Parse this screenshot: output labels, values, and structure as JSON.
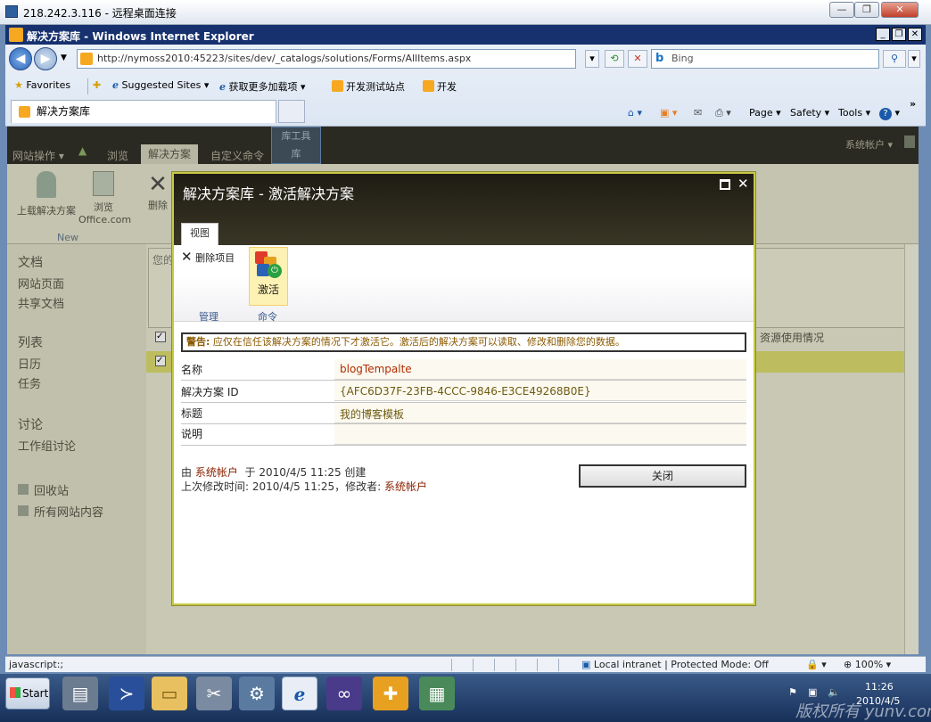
{
  "rdp": {
    "title": "218.242.3.116 - 远程桌面连接",
    "min": "—",
    "max": "❐",
    "close": "✕"
  },
  "ie": {
    "title": "解决方案库 - Windows Internet Explorer",
    "address": "http://nymoss2010:45223/sites/dev/_catalogs/solutions/Forms/AllItems.aspx",
    "search_placeholder": "Bing",
    "favorites": {
      "favorites_label": "Favorites",
      "suggested": "Suggested Sites ▾",
      "more_addons": "获取更多加载项 ▾",
      "dev_test": "开发测试站点",
      "dev": "开发"
    },
    "tab_title": "解决方案库",
    "commands": {
      "page": "Page ▾",
      "safety": "Safety ▾",
      "tools": "Tools ▾",
      "help": "?"
    }
  },
  "sharepoint": {
    "top_tabs": {
      "site_actions": "网站操作 ▾",
      "browse": "浏览",
      "solutions": "解决方案",
      "custom_cmds": "自定义命令",
      "lib_tools": "库工具",
      "library": "库"
    },
    "account": "系统帐户 ▾",
    "ribbon": {
      "upload": "上载解决方案",
      "browse_office": "浏览",
      "office_com": "Office.com",
      "delete": "删除",
      "group_new": "New"
    },
    "nav": {
      "documents": "文档",
      "site_pages": "网站页面",
      "shared_docs": "共享文档",
      "lists": "列表",
      "calendar": "日历",
      "tasks": "任务",
      "discussions": "讨论",
      "team_discussion": "工作组讨论",
      "recycle_bin": "回收站",
      "all_content": "所有网站内容"
    },
    "main": {
      "placeholder": "您的",
      "resource_col": "资源使用情况"
    }
  },
  "modal": {
    "title": "解决方案库 - 激活解决方案",
    "tab_view": "视图",
    "delete_item": "删除项目",
    "activate": "激活",
    "group_manage": "管理",
    "group_command": "命令",
    "warning_label": "警告:",
    "warning_text": " 应仅在信任该解决方案的情况下才激活它。激活后的解决方案可以读取、修改和删除您的数据。",
    "fields": [
      {
        "label": "名称",
        "value": "blogTempalte"
      },
      {
        "label": "解决方案 ID",
        "value": "{AFC6D37F-23FB-4CCC-9846-E3CE49268B0E}"
      },
      {
        "label": "标题",
        "value": "我的博客模板"
      },
      {
        "label": "说明",
        "value": ""
      }
    ],
    "created_prefix": "由",
    "created_by": "系统帐户",
    "created_text": "于 2010/4/5 11:25 创建",
    "modified_text": "上次修改时间: 2010/4/5 11:25，修改者:",
    "modified_by": "系统帐户",
    "close_button": "关闭"
  },
  "statusbar": {
    "left": "javascript:;",
    "zone": "Local intranet | Protected Mode: Off",
    "zoom": "100%"
  },
  "taskbar": {
    "start": "Start",
    "time": "11:26",
    "date": "2010/4/5"
  },
  "watermark": "版权所有 yunv.com"
}
